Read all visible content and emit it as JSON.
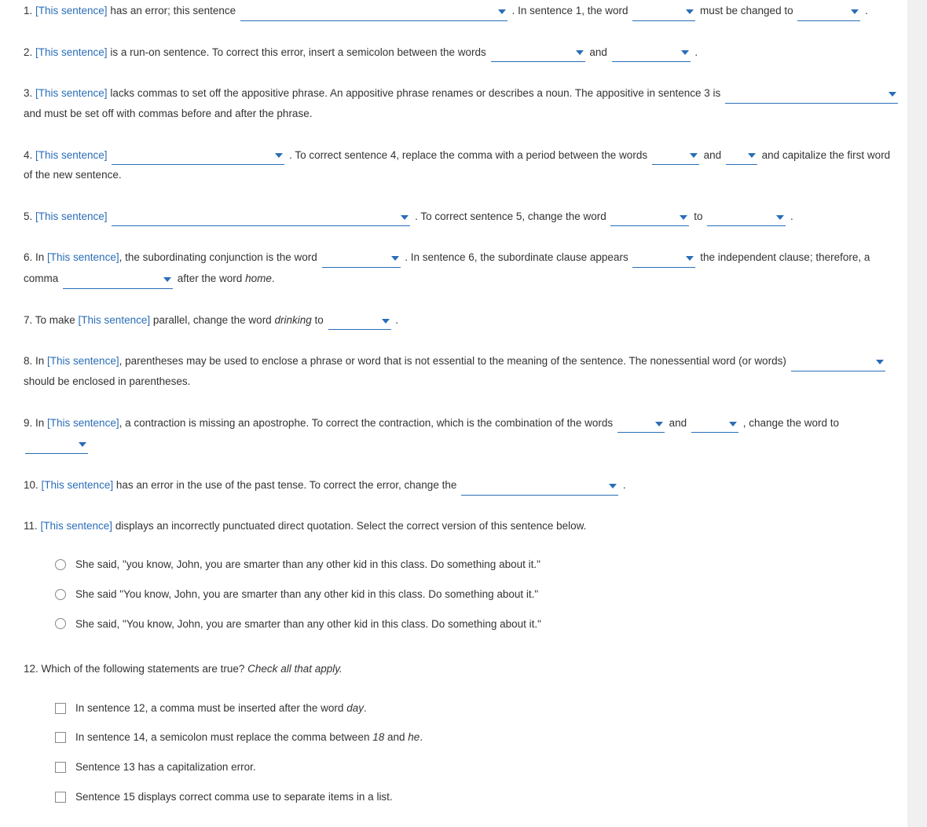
{
  "link_text": "[This sentence]",
  "questions": [
    {
      "num": "1.",
      "parts": [
        {
          "t": "link"
        },
        {
          "t": "text",
          "v": " has an error; this sentence "
        },
        {
          "t": "dd",
          "w": "w340"
        },
        {
          "t": "text",
          "v": " . In sentence 1, the word "
        },
        {
          "t": "dd",
          "w": "w80"
        },
        {
          "t": "text",
          "v": " must be changed to "
        },
        {
          "t": "dd",
          "w": "w80"
        },
        {
          "t": "text",
          "v": " ."
        }
      ]
    },
    {
      "num": "2.",
      "parts": [
        {
          "t": "link"
        },
        {
          "t": "text",
          "v": " is a run-on sentence. To correct this error, insert a semicolon between the words "
        },
        {
          "t": "dd",
          "w": "w120"
        },
        {
          "t": "text",
          "v": " and "
        },
        {
          "t": "dd",
          "w": "w100"
        },
        {
          "t": "text",
          "v": " ."
        }
      ]
    },
    {
      "num": "3.",
      "parts": [
        {
          "t": "link"
        },
        {
          "t": "text",
          "v": " lacks commas to set off the appositive phrase. An appositive phrase renames or describes a noun. The appositive in sentence 3 is "
        },
        {
          "t": "dd",
          "w": "w220"
        },
        {
          "t": "text",
          "v": " and must be set off with commas before and after the phrase."
        }
      ]
    },
    {
      "num": "4.",
      "parts": [
        {
          "t": "link"
        },
        {
          "t": "text",
          "v": " "
        },
        {
          "t": "dd",
          "w": "w220"
        },
        {
          "t": "text",
          "v": " . To correct sentence 4, replace the comma with a period between the words "
        },
        {
          "t": "dd",
          "w": "w60"
        },
        {
          "t": "text",
          "v": " and "
        },
        {
          "t": "dd",
          "w": "w40"
        },
        {
          "t": "text",
          "v": " and capitalize the first word of the new sentence."
        }
      ]
    },
    {
      "num": "5.",
      "parts": [
        {
          "t": "link"
        },
        {
          "t": "text",
          "v": " "
        },
        {
          "t": "dd",
          "w": "w380"
        },
        {
          "t": "text",
          "v": " . To correct sentence 5, change the word "
        },
        {
          "t": "dd",
          "w": "w100"
        },
        {
          "t": "text",
          "v": " to "
        },
        {
          "t": "dd",
          "w": "w100"
        },
        {
          "t": "text",
          "v": " ."
        }
      ]
    },
    {
      "num": "6.",
      "parts": [
        {
          "t": "text",
          "v": "In "
        },
        {
          "t": "link"
        },
        {
          "t": "text",
          "v": ", the subordinating conjunction is the word "
        },
        {
          "t": "dd",
          "w": "w100"
        },
        {
          "t": "text",
          "v": " . In sentence 6, the subordinate clause appears "
        },
        {
          "t": "dd",
          "w": "w80"
        },
        {
          "t": "text",
          "v": " the independent clause; therefore, a comma "
        },
        {
          "t": "dd",
          "w": "w140"
        },
        {
          "t": "text",
          "v": " after the word "
        },
        {
          "t": "em",
          "v": "home"
        },
        {
          "t": "text",
          "v": "."
        }
      ]
    },
    {
      "num": "7.",
      "parts": [
        {
          "t": "text",
          "v": "To make "
        },
        {
          "t": "link"
        },
        {
          "t": "text",
          "v": " parallel, change the word "
        },
        {
          "t": "em",
          "v": "drinking"
        },
        {
          "t": "text",
          "v": " to "
        },
        {
          "t": "dd",
          "w": "w80"
        },
        {
          "t": "text",
          "v": " ."
        }
      ]
    },
    {
      "num": "8.",
      "parts": [
        {
          "t": "text",
          "v": "In "
        },
        {
          "t": "link"
        },
        {
          "t": "text",
          "v": ", parentheses may be used to enclose a phrase or word that is not essential to the meaning of the sentence. The nonessential word (or words) "
        },
        {
          "t": "dd",
          "w": "w120"
        },
        {
          "t": "text",
          "v": " should be enclosed in parentheses."
        }
      ]
    },
    {
      "num": "9.",
      "parts": [
        {
          "t": "text",
          "v": "In "
        },
        {
          "t": "link"
        },
        {
          "t": "text",
          "v": ", a contraction is missing an apostrophe. To correct the contraction, which is the combination of the words "
        },
        {
          "t": "dd",
          "w": "w60"
        },
        {
          "t": "text",
          "v": " and "
        },
        {
          "t": "dd",
          "w": "w60"
        },
        {
          "t": "text",
          "v": " , change the word to "
        },
        {
          "t": "dd",
          "w": "w80"
        }
      ]
    },
    {
      "num": "10.",
      "parts": [
        {
          "t": "link"
        },
        {
          "t": "text",
          "v": " has an error in the use of the past tense. To correct the error, change the "
        },
        {
          "t": "dd",
          "w": "w200"
        },
        {
          "t": "text",
          "v": " ."
        }
      ]
    },
    {
      "num": "11.",
      "parts": [
        {
          "t": "link"
        },
        {
          "t": "text",
          "v": " displays an incorrectly punctuated direct quotation. Select the correct version of this sentence below."
        }
      ],
      "options_type": "radio",
      "options": [
        "She said, \"you know, John, you are smarter than any other kid in this class. Do something about it.\"",
        "She said \"You know, John, you are smarter than any other kid in this class. Do something about it.\"",
        "She said, \"You know, John, you are smarter than any other kid in this class. Do something about it.\""
      ]
    },
    {
      "num": "12.",
      "parts": [
        {
          "t": "text",
          "v": "Which of the following statements are true? "
        },
        {
          "t": "em",
          "v": "Check all that apply."
        }
      ],
      "options_type": "check",
      "options_rich": [
        [
          {
            "t": "text",
            "v": "In sentence 12, a comma must be inserted after the word "
          },
          {
            "t": "em",
            "v": "day"
          },
          {
            "t": "text",
            "v": "."
          }
        ],
        [
          {
            "t": "text",
            "v": "In sentence 14, a semicolon must replace the comma between "
          },
          {
            "t": "em",
            "v": "18"
          },
          {
            "t": "text",
            "v": " and "
          },
          {
            "t": "em",
            "v": "he"
          },
          {
            "t": "text",
            "v": "."
          }
        ],
        [
          {
            "t": "text",
            "v": "Sentence 13 has a capitalization error."
          }
        ],
        [
          {
            "t": "text",
            "v": "Sentence 15 displays correct comma use to separate items in a list."
          }
        ]
      ]
    }
  ]
}
